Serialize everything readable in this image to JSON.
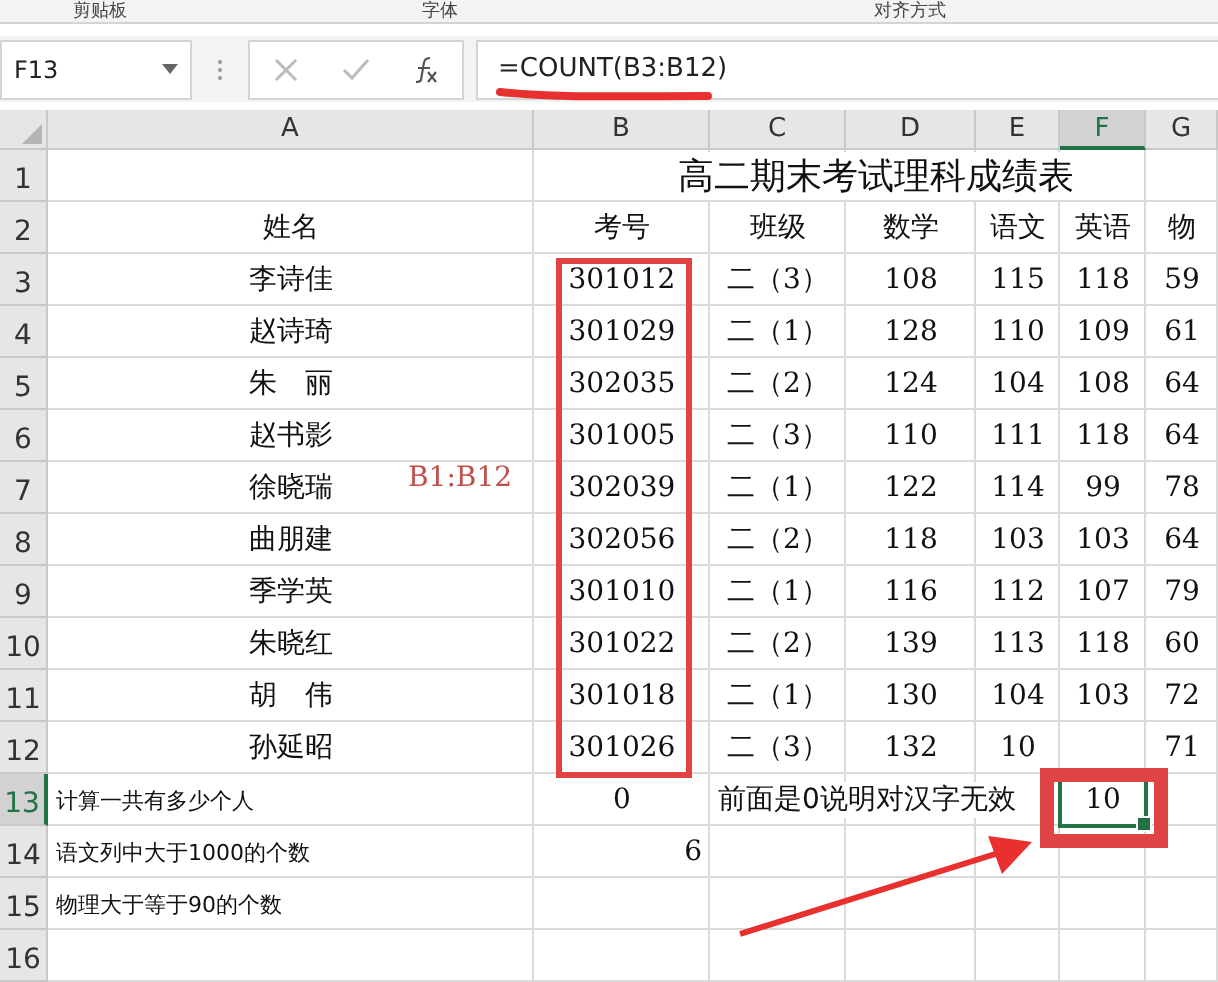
{
  "ribbon": {
    "groups": [
      "剪贴板",
      "字体",
      "对齐方式"
    ]
  },
  "formula_bar": {
    "name_box": "F13",
    "formula": "=COUNT(B3:B12)"
  },
  "columns": [
    {
      "label": "A",
      "selected": false
    },
    {
      "label": "B",
      "selected": false
    },
    {
      "label": "C",
      "selected": false
    },
    {
      "label": "D",
      "selected": false
    },
    {
      "label": "E",
      "selected": false
    },
    {
      "label": "F",
      "selected": true
    },
    {
      "label": "G",
      "selected": false
    }
  ],
  "rows": [
    {
      "number": "1",
      "selected": false,
      "kind": "title",
      "cells": [
        null,
        {
          "text": "高二期末考试理科成绩表",
          "kind": "merged"
        }
      ]
    },
    {
      "number": "2",
      "selected": false,
      "kind": "data",
      "cells": [
        {
          "text": "姓名"
        },
        {
          "text": "考号"
        },
        {
          "text": "班级"
        },
        {
          "text": "数学"
        },
        {
          "text": "语文"
        },
        {
          "text": "英语"
        },
        {
          "text": "物"
        }
      ]
    },
    {
      "number": "3",
      "selected": false,
      "kind": "data",
      "cells": [
        {
          "text": "李诗佳"
        },
        {
          "text": "301012"
        },
        {
          "text": "二（3）"
        },
        {
          "text": "108"
        },
        {
          "text": "115"
        },
        {
          "text": "118"
        },
        {
          "text": "59"
        }
      ]
    },
    {
      "number": "4",
      "selected": false,
      "kind": "data",
      "cells": [
        {
          "text": "赵诗琦"
        },
        {
          "text": "301029"
        },
        {
          "text": "二（1）"
        },
        {
          "text": "128"
        },
        {
          "text": "110"
        },
        {
          "text": "109"
        },
        {
          "text": "61"
        }
      ]
    },
    {
      "number": "5",
      "selected": false,
      "kind": "data",
      "cells": [
        {
          "text": "朱　丽"
        },
        {
          "text": "302035"
        },
        {
          "text": "二（2）"
        },
        {
          "text": "124"
        },
        {
          "text": "104"
        },
        {
          "text": "108"
        },
        {
          "text": "64"
        }
      ]
    },
    {
      "number": "6",
      "selected": false,
      "kind": "data",
      "cells": [
        {
          "text": "赵书影"
        },
        {
          "text": "301005"
        },
        {
          "text": "二（3）"
        },
        {
          "text": "110"
        },
        {
          "text": "111"
        },
        {
          "text": "118"
        },
        {
          "text": "64"
        }
      ]
    },
    {
      "number": "7",
      "selected": false,
      "kind": "data",
      "cells": [
        {
          "text": "徐晓瑞"
        },
        {
          "text": "302039"
        },
        {
          "text": "二（1）"
        },
        {
          "text": "122"
        },
        {
          "text": "114"
        },
        {
          "text": "99"
        },
        {
          "text": "78"
        }
      ]
    },
    {
      "number": "8",
      "selected": false,
      "kind": "data",
      "cells": [
        {
          "text": "曲朋建"
        },
        {
          "text": "302056"
        },
        {
          "text": "二（2）"
        },
        {
          "text": "118"
        },
        {
          "text": "103"
        },
        {
          "text": "103"
        },
        {
          "text": "64"
        }
      ]
    },
    {
      "number": "9",
      "selected": false,
      "kind": "data",
      "cells": [
        {
          "text": "季学英"
        },
        {
          "text": "301010"
        },
        {
          "text": "二（1）"
        },
        {
          "text": "116"
        },
        {
          "text": "112"
        },
        {
          "text": "107"
        },
        {
          "text": "79"
        }
      ]
    },
    {
      "number": "10",
      "selected": false,
      "kind": "data",
      "cells": [
        {
          "text": "朱晓红"
        },
        {
          "text": "301022"
        },
        {
          "text": "二（2）"
        },
        {
          "text": "139"
        },
        {
          "text": "113"
        },
        {
          "text": "118"
        },
        {
          "text": "60"
        }
      ]
    },
    {
      "number": "11",
      "selected": false,
      "kind": "data",
      "cells": [
        {
          "text": "胡　伟"
        },
        {
          "text": "301018"
        },
        {
          "text": "二（1）"
        },
        {
          "text": "130"
        },
        {
          "text": "104"
        },
        {
          "text": "103"
        },
        {
          "text": "72"
        }
      ]
    },
    {
      "number": "12",
      "selected": false,
      "kind": "data",
      "cells": [
        {
          "text": "孙延昭"
        },
        {
          "text": "301026"
        },
        {
          "text": "二（3）"
        },
        {
          "text": "132"
        },
        {
          "text": "10"
        },
        null,
        {
          "text": "71"
        }
      ]
    },
    {
      "number": "13",
      "selected": true,
      "kind": "note",
      "cells": [
        {
          "text": "计算一共有多少个人"
        },
        {
          "text": "0"
        },
        {
          "text": "前面是0说明对汉字无效",
          "kind": "merged"
        },
        {
          "text": "10",
          "selected": true
        },
        null
      ]
    },
    {
      "number": "14",
      "selected": false,
      "kind": "note",
      "cells": [
        {
          "text": "语文列中大于1000的个数"
        },
        {
          "text": "6",
          "kind": "number"
        }
      ]
    },
    {
      "number": "15",
      "selected": false,
      "kind": "note",
      "cells": [
        {
          "text": "物理大于等于90的个数"
        }
      ]
    },
    {
      "number": "16",
      "selected": false,
      "kind": "note",
      "cells": []
    }
  ],
  "annotation": {
    "range_label": "B1:B12"
  }
}
